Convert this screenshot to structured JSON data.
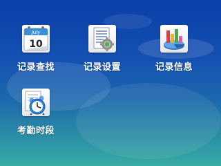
{
  "menu": {
    "items": [
      {
        "label": "记录查找",
        "icon": "calendar-icon",
        "calendar_month": "July",
        "calendar_day": "10"
      },
      {
        "label": "记录设置",
        "icon": "document-settings-icon"
      },
      {
        "label": "记录信息",
        "icon": "chart-info-icon"
      },
      {
        "label": "考勤时段",
        "icon": "alarm-clock-icon"
      }
    ]
  },
  "colors": {
    "background_top": "#0b3fa8",
    "background_bottom": "#38aba3",
    "label_text": "#ffffff"
  }
}
